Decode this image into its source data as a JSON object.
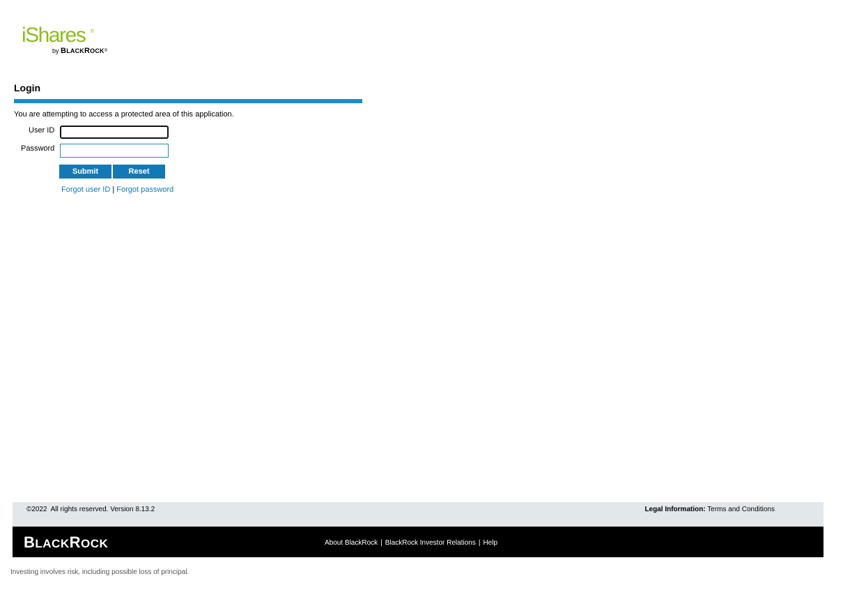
{
  "logo": {
    "primary": "iShares",
    "registered": "®",
    "by": "by",
    "brand_cap1": "B",
    "brand_rest1": "LACK",
    "brand_cap2": "R",
    "brand_rest2": "OCK",
    "brand_reg": "®",
    "color": "#8dbb1e"
  },
  "login": {
    "title": "Login",
    "notice": "You are attempting to access a protected area of this application.",
    "user_id_label": "User ID",
    "user_id_value": "",
    "password_label": "Password",
    "password_value": "",
    "submit_label": "Submit",
    "reset_label": "Reset",
    "forgot_user_id": "Forgot user ID",
    "separator": "|",
    "forgot_password": "Forgot password",
    "accent_color": "#1f8bc4",
    "button_color": "#1478b5"
  },
  "footer": {
    "copyright": "©2022  All rights reserved. Version 8.13.2",
    "legal_label": "Legal Information:",
    "legal_link": "Terms and Conditions",
    "brand_cap1": "B",
    "brand_rest1": "LACK",
    "brand_cap2": "R",
    "brand_rest2": "OCK",
    "links": [
      "About BlackRock",
      "BlackRock Investor Relations",
      "Help"
    ],
    "link_separator": "|",
    "disclaimer": "Investing involves risk, including possible loss of principal."
  }
}
